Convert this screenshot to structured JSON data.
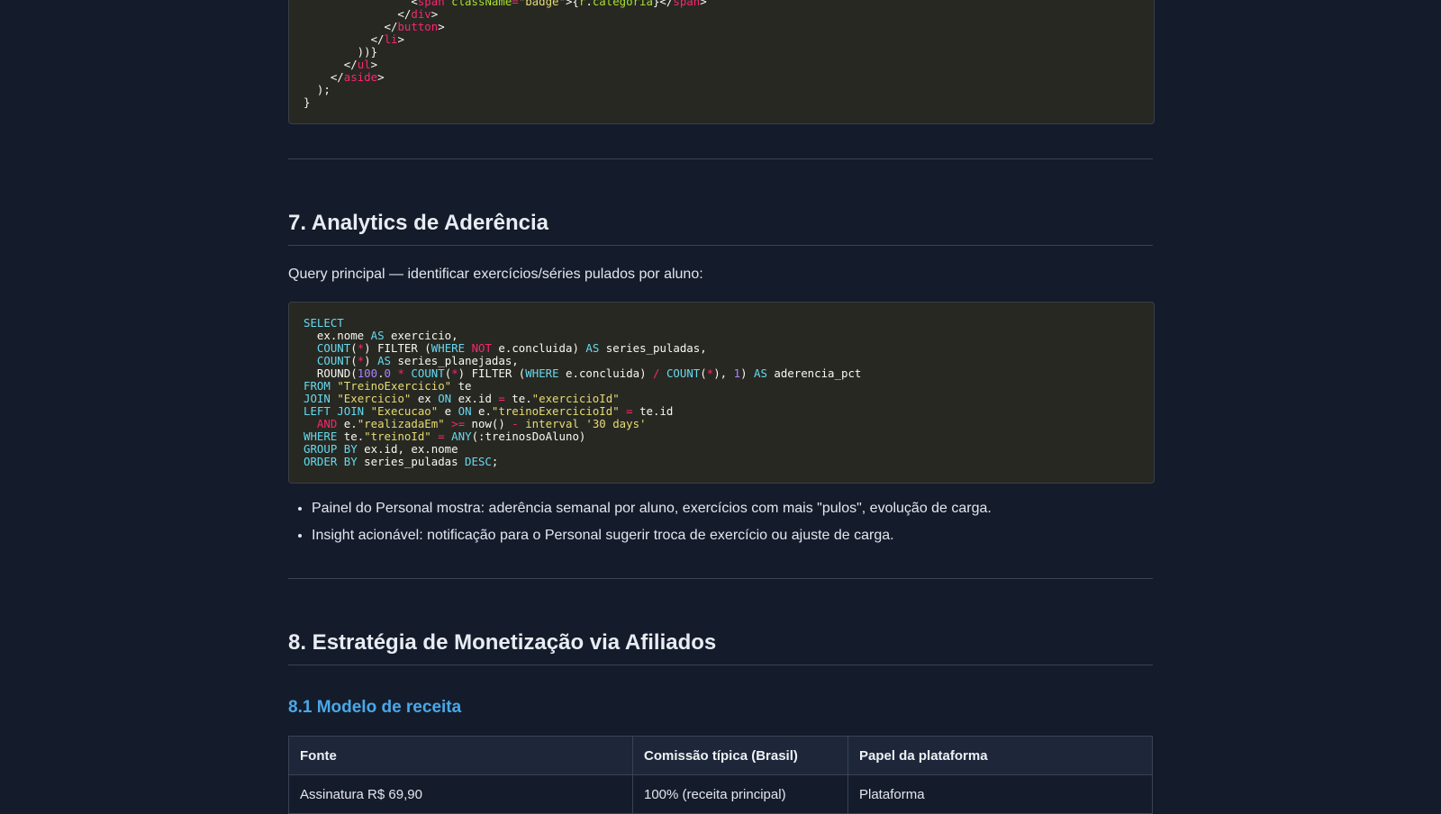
{
  "code_top": {
    "lines": [
      [
        [
          "                ",
          ""
        ],
        [
          "<",
          ""
        ],
        [
          "span",
          "t"
        ],
        [
          " ",
          ""
        ],
        [
          "className",
          "a"
        ],
        [
          "=",
          "o"
        ],
        [
          "\"badge\"",
          "s"
        ],
        [
          ">{",
          ""
        ],
        [
          "r",
          "a"
        ],
        [
          ".",
          ""
        ],
        [
          "categoria",
          "a"
        ],
        [
          "}</",
          ""
        ],
        [
          "span",
          "t"
        ],
        [
          ">",
          ""
        ]
      ],
      [
        [
          "              </",
          ""
        ],
        [
          "div",
          "t"
        ],
        [
          ">",
          ""
        ]
      ],
      [
        [
          "            </",
          ""
        ],
        [
          "button",
          "t"
        ],
        [
          ">",
          ""
        ]
      ],
      [
        [
          "          </",
          ""
        ],
        [
          "li",
          "t"
        ],
        [
          ">",
          ""
        ]
      ],
      [
        [
          "        ))}",
          ""
        ]
      ],
      [
        [
          "      </",
          ""
        ],
        [
          "ul",
          "t"
        ],
        [
          ">",
          ""
        ]
      ],
      [
        [
          "    </",
          ""
        ],
        [
          "aside",
          "t"
        ],
        [
          ">",
          ""
        ]
      ],
      [
        [
          "  );",
          ""
        ]
      ],
      [
        [
          "}",
          ""
        ]
      ]
    ]
  },
  "section7": {
    "heading": "7. Analytics de Aderência",
    "intro": "Query principal — identificar exercícios/séries pulados por aluno:",
    "sql_lines": [
      [
        [
          "SELECT",
          "k"
        ]
      ],
      [
        [
          "  ex.nome ",
          ""
        ],
        [
          "AS",
          "k"
        ],
        [
          " exercicio,",
          ""
        ]
      ],
      [
        [
          "  ",
          ""
        ],
        [
          "COUNT",
          "k"
        ],
        [
          "(",
          ""
        ],
        [
          "*",
          "o"
        ],
        [
          ") FILTER (",
          ""
        ],
        [
          "WHERE",
          "k"
        ],
        [
          " ",
          ""
        ],
        [
          "NOT",
          "o"
        ],
        [
          " e.concluida) ",
          ""
        ],
        [
          "AS",
          "k"
        ],
        [
          " series_puladas,",
          ""
        ]
      ],
      [
        [
          "  ",
          ""
        ],
        [
          "COUNT",
          "k"
        ],
        [
          "(",
          ""
        ],
        [
          "*",
          "o"
        ],
        [
          ") ",
          ""
        ],
        [
          "AS",
          "k"
        ],
        [
          " series_planejadas,",
          ""
        ]
      ],
      [
        [
          "  ROUND(",
          ""
        ],
        [
          "100",
          "n"
        ],
        [
          ".",
          ""
        ],
        [
          "0",
          "n"
        ],
        [
          " ",
          ""
        ],
        [
          "*",
          "o"
        ],
        [
          " ",
          ""
        ],
        [
          "COUNT",
          "k"
        ],
        [
          "(",
          ""
        ],
        [
          "*",
          "o"
        ],
        [
          ") FILTER (",
          ""
        ],
        [
          "WHERE",
          "k"
        ],
        [
          " e.concluida) ",
          ""
        ],
        [
          "/",
          "o"
        ],
        [
          " ",
          ""
        ],
        [
          "COUNT",
          "k"
        ],
        [
          "(",
          ""
        ],
        [
          "*",
          "o"
        ],
        [
          "), ",
          ""
        ],
        [
          "1",
          "n"
        ],
        [
          ") ",
          ""
        ],
        [
          "AS",
          "k"
        ],
        [
          " aderencia_pct",
          ""
        ]
      ],
      [
        [
          "FROM",
          "k"
        ],
        [
          " ",
          ""
        ],
        [
          "\"TreinoExercicio\"",
          "s"
        ],
        [
          " te",
          ""
        ]
      ],
      [
        [
          "JOIN",
          "k"
        ],
        [
          " ",
          ""
        ],
        [
          "\"Exercicio\"",
          "s"
        ],
        [
          " ex ",
          ""
        ],
        [
          "ON",
          "k"
        ],
        [
          " ex.id ",
          ""
        ],
        [
          "=",
          "o"
        ],
        [
          " te.",
          ""
        ],
        [
          "\"exercicioId\"",
          "s"
        ]
      ],
      [
        [
          "LEFT JOIN",
          "k"
        ],
        [
          " ",
          ""
        ],
        [
          "\"Execucao\"",
          "s"
        ],
        [
          " e ",
          ""
        ],
        [
          "ON",
          "k"
        ],
        [
          " e.",
          ""
        ],
        [
          "\"treinoExercicioId\"",
          "s"
        ],
        [
          " ",
          ""
        ],
        [
          "=",
          "o"
        ],
        [
          " te.id",
          ""
        ]
      ],
      [
        [
          "  ",
          ""
        ],
        [
          "AND",
          "o"
        ],
        [
          " e.",
          ""
        ],
        [
          "\"realizadaEm\"",
          "s"
        ],
        [
          " ",
          ""
        ],
        [
          ">=",
          "o"
        ],
        [
          " now() ",
          ""
        ],
        [
          "-",
          "o"
        ],
        [
          " interval '30 days'",
          "s"
        ]
      ],
      [
        [
          "WHERE",
          "k"
        ],
        [
          " te.",
          ""
        ],
        [
          "\"treinoId\"",
          "s"
        ],
        [
          " ",
          ""
        ],
        [
          "=",
          "o"
        ],
        [
          " ",
          ""
        ],
        [
          "ANY",
          "k"
        ],
        [
          "(:treinosDoAluno)",
          ""
        ]
      ],
      [
        [
          "GROUP BY",
          "k"
        ],
        [
          " ex.id, ex.nome",
          ""
        ]
      ],
      [
        [
          "ORDER BY",
          "k"
        ],
        [
          " series_puladas ",
          ""
        ],
        [
          "DESC",
          "k"
        ],
        [
          ";",
          ""
        ]
      ]
    ],
    "bullets": [
      "Painel do Personal mostra: aderência semanal por aluno, exercícios com mais \"pulos\", evolução de carga.",
      "Insight acionável: notificação para o Personal sugerir troca de exercício ou ajuste de carga."
    ]
  },
  "section8": {
    "heading": "8. Estratégia de Monetização via Afiliados",
    "subheading": "8.1 Modelo de receita",
    "table": {
      "headers": [
        "Fonte",
        "Comissão típica (Brasil)",
        "Papel da plataforma"
      ],
      "rows": [
        [
          "Assinatura R$ 69,90",
          "100% (receita principal)",
          "Plataforma"
        ]
      ]
    }
  }
}
